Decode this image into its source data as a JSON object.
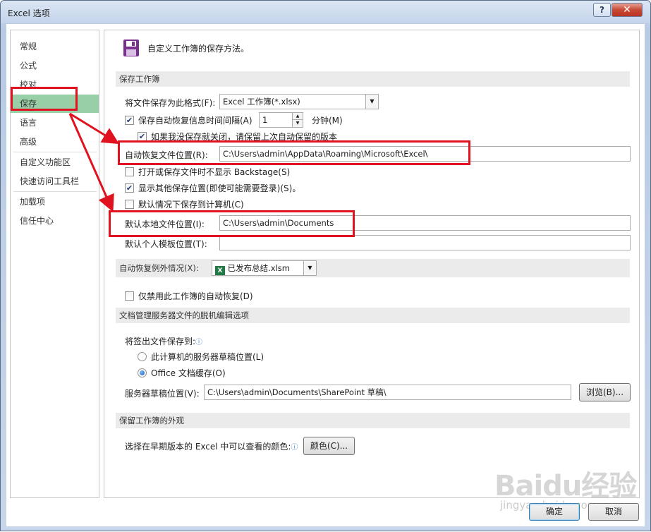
{
  "window": {
    "title": "Excel 选项",
    "help_label": "?",
    "close_label": "✕"
  },
  "nav": {
    "items": [
      {
        "label": "常规"
      },
      {
        "label": "公式"
      },
      {
        "label": "校对"
      },
      {
        "label": "保存"
      },
      {
        "label": "语言"
      },
      {
        "label": "高级"
      },
      {
        "label": "自定义功能区"
      },
      {
        "label": "快速访问工具栏"
      },
      {
        "label": "加载项"
      },
      {
        "label": "信任中心"
      }
    ],
    "active": "保存"
  },
  "header": {
    "text": "自定义工作簿的保存方法。",
    "icon": "floppy-disk-icon"
  },
  "save_section": {
    "title": "保存工作簿",
    "format_label": "将文件保存为此格式(F):",
    "format_value": "Excel 工作簿(*.xlsx)",
    "autosave_label": "保存自动恢复信息时间间隔(A)",
    "autosave_checked": true,
    "autosave_minutes": "1",
    "minutes_label": "分钟(M)",
    "keep_last_label": "如果我没保存就关闭，请保留上次自动保留的版本",
    "keep_last_checked": true,
    "autorecover_label": "自动恢复文件位置(R):",
    "autorecover_path": "C:\\Users\\admin\\AppData\\Roaming\\Microsoft\\Excel\\",
    "no_backstage_label": "打开或保存文件时不显示 Backstage(S)",
    "no_backstage_checked": false,
    "show_other_label": "显示其他保存位置(即使可能需要登录)(S)。",
    "show_other_checked": true,
    "default_computer_label": "默认情况下保存到计算机(C)",
    "default_computer_checked": false,
    "local_path_label": "默认本地文件位置(I):",
    "local_path": "C:\\Users\\admin\\Documents",
    "template_label": "默认个人模板位置(T):",
    "template_path": ""
  },
  "autorecover_exceptions": {
    "title": "自动恢复例外情况(X):",
    "workbook": "已发布总结.xlsm",
    "disable_label": "仅禁用此工作簿的自动恢复(D)",
    "disable_checked": false
  },
  "offline_section": {
    "title": "文档管理服务器文件的脱机编辑选项",
    "save_to_label": "将签出文件保存到:",
    "radio_server_label": "此计算机的服务器草稿位置(L)",
    "radio_cache_label": "Office 文档缓存(O)",
    "selected": "Office 文档缓存(O)",
    "drafts_label": "服务器草稿位置(V):",
    "drafts_path": "C:\\Users\\admin\\Documents\\SharePoint 草稿\\",
    "browse_label": "浏览(B)..."
  },
  "appearance_section": {
    "title": "保留工作簿的外观",
    "colors_label": "选择在早期版本的 Excel 中可以查看的颜色:",
    "colors_button": "颜色(C)..."
  },
  "footer": {
    "ok_label": "确定",
    "cancel_label": "取消"
  },
  "watermark": {
    "text": "Baidu经验",
    "sub": "jingyan.baidu.com"
  },
  "colors": {
    "annotation": "#e0121f",
    "nav_active": "#99cfa6"
  }
}
